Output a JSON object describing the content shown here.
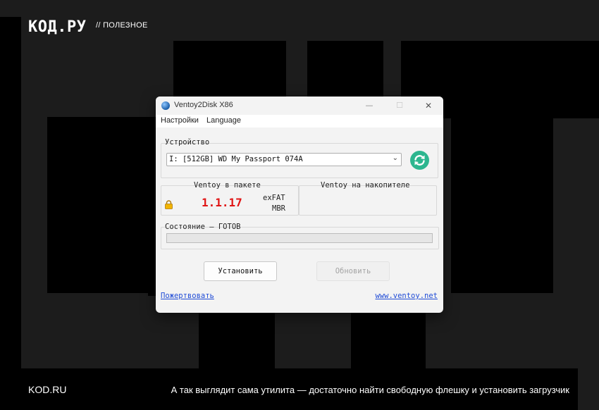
{
  "site": {
    "logo": "КОД.РУ",
    "section": "// ПОЛЕЗНОЕ",
    "footer_brand": "KOD.RU",
    "footer_caption": "А так выглядит сама утилита — достаточно найти свободную флешку и установить загрузчик"
  },
  "window": {
    "title": "Ventoy2Disk  X86",
    "controls": {
      "minimize": "—",
      "maximize": "☐",
      "close": "✕"
    },
    "menu": [
      "Настройки",
      "Language"
    ],
    "device": {
      "label": "Устройство",
      "selected": "I: [512GB] WD My Passport 074A"
    },
    "package": {
      "label": "Ventoy в пакете",
      "version": "1.1.17",
      "fs": "exFAT",
      "partition": "MBR"
    },
    "device_version": {
      "label": "Ventoy на накопителе"
    },
    "status": {
      "label": "Состояние — ГОТОВ",
      "progress": 0
    },
    "buttons": {
      "install": "Установить",
      "update": "Обновить"
    },
    "links": {
      "donate": "Пожертвовать",
      "website": "www.ventoy.net"
    }
  },
  "colors": {
    "version": "#e01515",
    "refresh": "#2db68f",
    "link": "#1f4bd6"
  },
  "icons": {
    "app": "ventoy-app-icon",
    "refresh": "refresh-icon",
    "lock": "lock-icon",
    "chevron": "chevron-down-icon"
  }
}
